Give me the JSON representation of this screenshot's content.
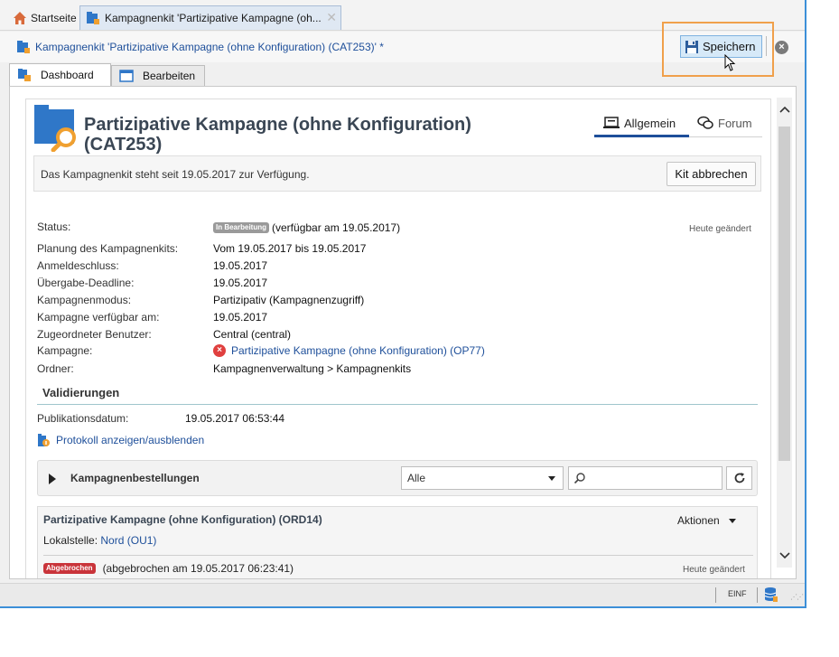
{
  "colors": {
    "accent_blue": "#1e4f9a",
    "save_highlight": "#f0a04b",
    "badge_grey": "#9a9a9a",
    "badge_red": "#c9343a",
    "error_red": "#e0403f"
  },
  "top_tabs": [
    {
      "label": "Startseite",
      "icon": "home-icon"
    },
    {
      "label": "Kampagnenkit 'Partizipative Kampagne (oh...",
      "icon": "campaign-kit-icon"
    }
  ],
  "document": {
    "title": "Kampagnenkit 'Partizipative Kampagne (ohne Konfiguration) (CAT253)' *",
    "save_label": "Speichern"
  },
  "sub_tabs": [
    {
      "label": "Dashboard",
      "active": true
    },
    {
      "label": "Bearbeiten",
      "active": false
    }
  ],
  "main": {
    "title": "Partizipative Kampagne (ohne Konfiguration) (CAT253)",
    "view_tabs": [
      {
        "label": "Allgemein",
        "active": true
      },
      {
        "label": "Forum",
        "active": false
      }
    ],
    "info_text": "Das Kampagnenkit steht seit 19.05.2017 zur Verfügung.",
    "cancel_kit_label": "Kit abbrechen",
    "fields": {
      "status": {
        "label": "Status:",
        "badge": "In Bearbeitung",
        "value": "(verfügbar am 19.05.2017)",
        "note": "Heute geändert"
      },
      "planning": {
        "label": "Planung des Kampagnenkits:",
        "value": "Vom 19.05.2017 bis 19.05.2017"
      },
      "registration_deadline": {
        "label": "Anmeldeschluss:",
        "value": "19.05.2017"
      },
      "handover_deadline": {
        "label": "Übergabe-Deadline:",
        "value": "19.05.2017"
      },
      "campaign_mode": {
        "label": "Kampagnenmodus:",
        "value": "Partizipativ (Kampagnenzugriff)"
      },
      "campaign_available": {
        "label": "Kampagne verfügbar am:",
        "value": "19.05.2017"
      },
      "assigned_user": {
        "label": "Zugeordneter Benutzer:",
        "value": "Central (central)"
      },
      "campaign": {
        "label": "Kampagne:",
        "value": "Partizipative Kampagne (ohne Konfiguration) (OP77)"
      },
      "folder": {
        "label": "Ordner:",
        "value": "Kampagnenverwaltung > Kampagnenkits"
      }
    },
    "validations": {
      "heading": "Validierungen",
      "pub_label": "Publikationsdatum:",
      "pub_value": "19.05.2017 06:53:44",
      "log_link": "Protokoll anzeigen/ausblenden"
    },
    "orders": {
      "title": "Kampagnenbestellungen",
      "filter_value": "Alle",
      "search_placeholder": ""
    },
    "order": {
      "title": "Partizipative Kampagne (ohne Konfiguration) (ORD14)",
      "local_label": "Lokalstelle:",
      "local_value": "Nord (OU1)",
      "actions_label": "Aktionen",
      "status_badge": "Abgebrochen",
      "status_text": "(abgebrochen am 19.05.2017 06:23:41)",
      "note": "Heute geändert"
    }
  },
  "status_bar": {
    "mode": "EINF"
  }
}
